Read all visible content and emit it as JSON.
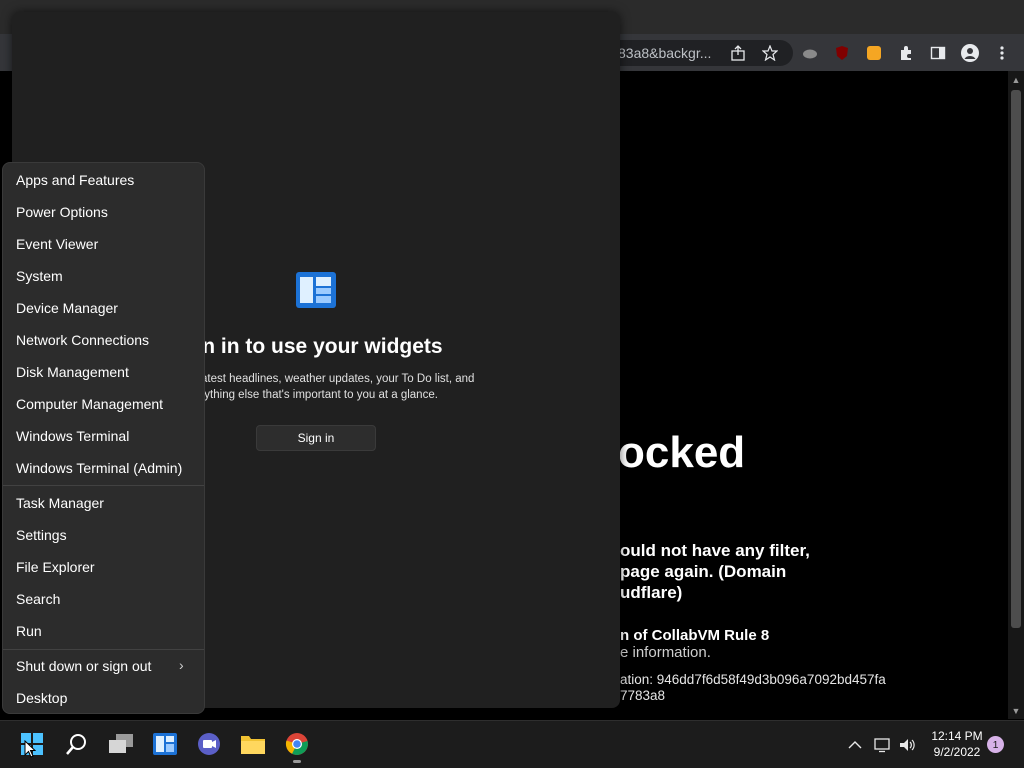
{
  "browser": {
    "address_fragment": "83a8&backgr...",
    "window_controls": [
      "chevron-down-icon",
      "minimize-icon",
      "restore-icon",
      "close-icon"
    ],
    "toolbar_icons": [
      "share-icon",
      "bookmark-star-icon",
      "extension-cloud-icon",
      "ublock-icon",
      "brave-extension-icon",
      "puzzle-extensions-icon",
      "sidebar-icon",
      "profile-icon",
      "more-menu-icon"
    ]
  },
  "page": {
    "blocked_title": "ocked",
    "blocked_desc": [
      "ould not have any filter,",
      "page again. (Domain",
      "udflare)"
    ],
    "rule_title": "n of CollabVM Rule 8",
    "more_info": "e information.",
    "ray_id": [
      "ation: 946dd7f6d58f49d3b096a7092bd457fa",
      "7783a8"
    ]
  },
  "widgets": {
    "title": "gn in to use your widgets",
    "subtitle": [
      "s to the latest headlines, weather updates, your To Do list, and",
      "erything else that's important to you at a glance."
    ],
    "signin_button": "Sign in"
  },
  "context_menu": {
    "group1": [
      "Apps and Features",
      "Power Options",
      "Event Viewer",
      "System",
      "Device Manager",
      "Network Connections",
      "Disk Management",
      "Computer Management",
      "Windows Terminal",
      "Windows Terminal (Admin)"
    ],
    "group2": [
      "Task Manager",
      "Settings",
      "File Explorer",
      "Search",
      "Run"
    ],
    "group3": [
      "Shut down or sign out",
      "Desktop"
    ],
    "submenu_chevron": "›"
  },
  "taskbar": {
    "apps": [
      "start-icon",
      "search-icon",
      "task-view-icon",
      "widgets-icon",
      "teams-chat-icon",
      "file-explorer-icon",
      "chrome-icon"
    ],
    "time": "12:14 PM",
    "date": "9/2/2022",
    "notification_count": "1",
    "tray": [
      "chevron-up-icon",
      "network-icon",
      "volume-icon"
    ]
  },
  "colors": {
    "accent": "#0078d4",
    "panel": "#202020",
    "menu": "#2c2c2c",
    "taskbar": "#1c1c1c",
    "notification_badge": "#d7b2e8"
  }
}
